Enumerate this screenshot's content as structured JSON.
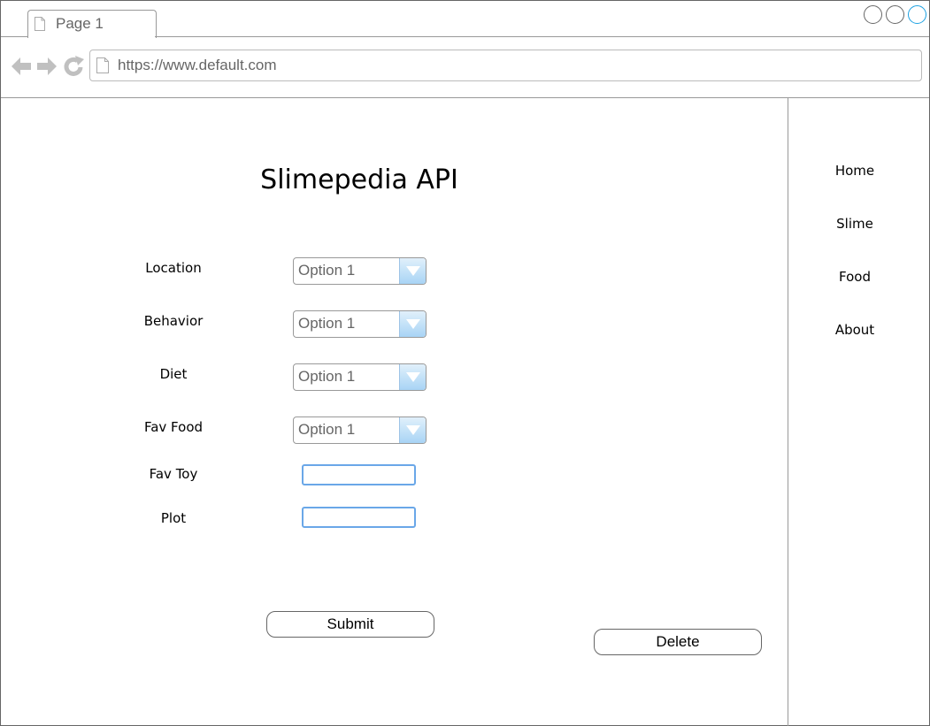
{
  "browser": {
    "tab_label": "Page 1",
    "url": "https://www.default.com",
    "icons": [
      "page-icon",
      "back-arrow-icon",
      "forward-arrow-icon",
      "reload-icon",
      "window-control-icon"
    ],
    "accent_color": "#1ba1e2"
  },
  "sidebar": {
    "items": [
      {
        "label": "Home"
      },
      {
        "label": "Slime"
      },
      {
        "label": "Food"
      },
      {
        "label": "About"
      }
    ]
  },
  "main": {
    "title": "Slimepedia API",
    "fields": [
      {
        "label": "Location",
        "type": "select",
        "value": "Option 1"
      },
      {
        "label": "Behavior",
        "type": "select",
        "value": "Option 1"
      },
      {
        "label": "Diet",
        "type": "select",
        "value": "Option 1"
      },
      {
        "label": "Fav Food",
        "type": "select",
        "value": "Option 1"
      },
      {
        "label": "Fav Toy",
        "type": "text",
        "value": ""
      },
      {
        "label": "Plot",
        "type": "text",
        "value": ""
      }
    ],
    "submit_label": "Submit",
    "delete_label": "Delete",
    "input_border_color": "#6aa7e8",
    "select_button_color": "#a8d4f5"
  }
}
